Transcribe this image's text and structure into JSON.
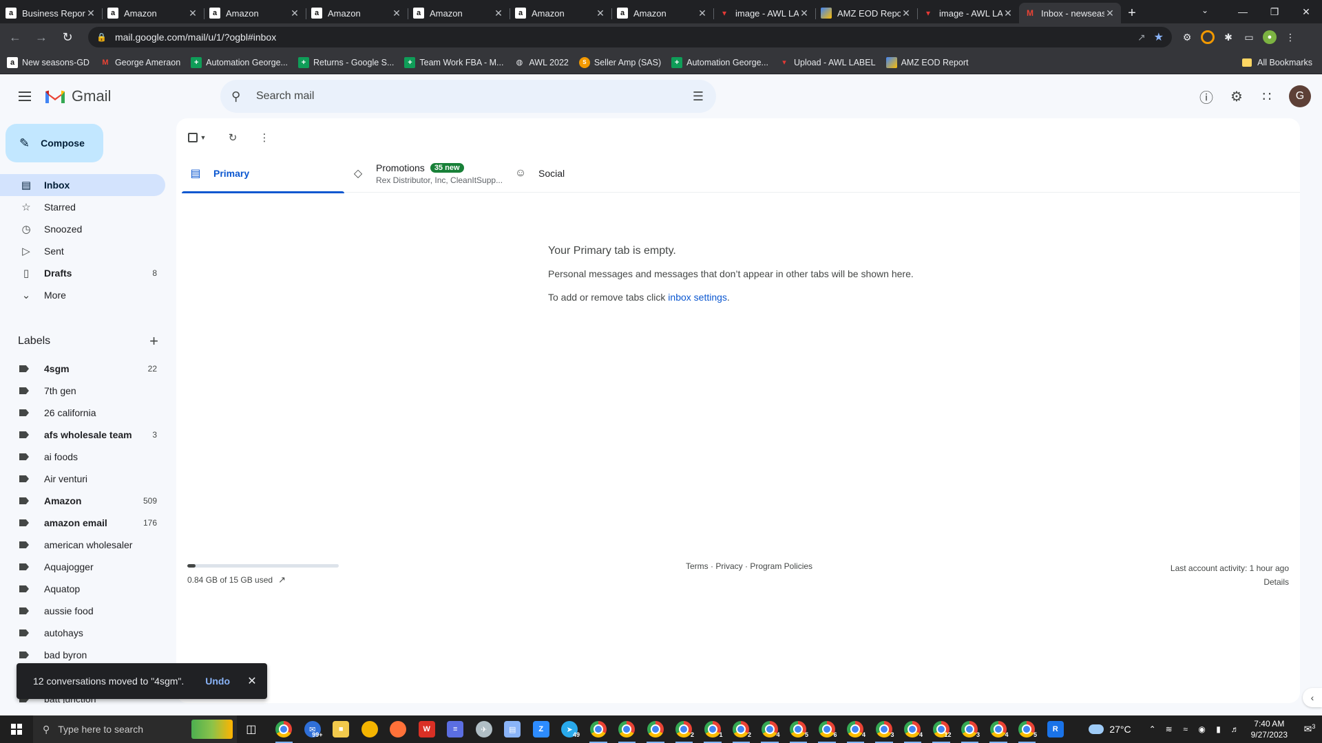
{
  "browser": {
    "tabs": [
      {
        "title": "Business Reports",
        "icon": "amazon-icon"
      },
      {
        "title": "Amazon",
        "icon": "amazon-icon"
      },
      {
        "title": "Amazon",
        "icon": "amazon-icon"
      },
      {
        "title": "Amazon",
        "icon": "amazon-icon"
      },
      {
        "title": "Amazon",
        "icon": "amazon-icon"
      },
      {
        "title": "Amazon",
        "icon": "amazon-icon"
      },
      {
        "title": "Amazon",
        "icon": "amazon-icon"
      },
      {
        "title": "image - AWL LABEL",
        "icon": "awl-icon"
      },
      {
        "title": "AMZ EOD Report",
        "icon": "eod-icon"
      },
      {
        "title": "image - AWL LABEL",
        "icon": "awl-icon"
      },
      {
        "title": "Inbox - newseasons",
        "icon": "gmail-icon",
        "active": true
      }
    ],
    "url": "mail.google.com/mail/u/1/?ogbl#inbox",
    "bookmarks": [
      {
        "label": "New seasons-GD",
        "icon": "amazon-icon"
      },
      {
        "label": "George Ameraon",
        "icon": "gmail-icon"
      },
      {
        "label": "Automation George...",
        "icon": "sheets-icon"
      },
      {
        "label": "Returns - Google S...",
        "icon": "sheets-icon"
      },
      {
        "label": "Team Work FBA - M...",
        "icon": "sheets-icon"
      },
      {
        "label": "AWL 2022",
        "icon": "globe-icon"
      },
      {
        "label": "Seller Amp (SAS)",
        "icon": "selleramp-icon"
      },
      {
        "label": "Automation George...",
        "icon": "sheets-icon"
      },
      {
        "label": "Upload - AWL LABEL",
        "icon": "awl-icon"
      },
      {
        "label": "AMZ EOD Report",
        "icon": "eod-icon"
      }
    ],
    "all_bookmarks": "All Bookmarks"
  },
  "gmail": {
    "product": "Gmail",
    "search_placeholder": "Search mail",
    "avatar_letter": "G",
    "compose": "Compose",
    "nav": [
      {
        "label": "Inbox",
        "icon": "inbox-icon",
        "count": "",
        "active": true
      },
      {
        "label": "Starred",
        "icon": "star-icon",
        "count": ""
      },
      {
        "label": "Snoozed",
        "icon": "clock-icon",
        "count": ""
      },
      {
        "label": "Sent",
        "icon": "send-icon",
        "count": ""
      },
      {
        "label": "Drafts",
        "icon": "draft-icon",
        "count": "8",
        "bold": true
      },
      {
        "label": "More",
        "icon": "chevron-down-icon",
        "count": ""
      }
    ],
    "labels_title": "Labels",
    "labels": [
      {
        "name": "4sgm",
        "count": "22",
        "bold": true
      },
      {
        "name": "7th gen",
        "count": ""
      },
      {
        "name": "26 california",
        "count": ""
      },
      {
        "name": "afs wholesale team",
        "count": "3",
        "bold": true
      },
      {
        "name": "ai foods",
        "count": ""
      },
      {
        "name": "Air venturi",
        "count": ""
      },
      {
        "name": "Amazon",
        "count": "509",
        "bold": true
      },
      {
        "name": "amazon email",
        "count": "176",
        "bold": true
      },
      {
        "name": "american wholesaler",
        "count": ""
      },
      {
        "name": "Aquajogger",
        "count": ""
      },
      {
        "name": "Aquatop",
        "count": ""
      },
      {
        "name": "aussie food",
        "count": ""
      },
      {
        "name": "autohays",
        "count": ""
      },
      {
        "name": "bad byron",
        "count": ""
      },
      {
        "name": "",
        "count": ""
      },
      {
        "name": "batt junction",
        "count": ""
      }
    ],
    "inbox_tabs": [
      {
        "label": "Primary",
        "icon": "inbox-icon",
        "active": true
      },
      {
        "label": "Promotions",
        "icon": "tag-icon",
        "badge": "35 new",
        "sub": "Rex Distributor, Inc, CleanItSupp..."
      },
      {
        "label": "Social",
        "icon": "people-icon"
      }
    ],
    "empty": {
      "heading": "Your Primary tab is empty.",
      "line1": "Personal messages and messages that don’t appear in other tabs will be shown here.",
      "line2_prefix": "To add or remove tabs click ",
      "line2_link": "inbox settings",
      "line2_suffix": "."
    },
    "footer": {
      "storage_used": "0.84 GB of 15 GB used",
      "storage_fraction": 0.056,
      "policies": "Terms · Privacy · Program Policies",
      "activity": "Last account activity: 1 hour ago",
      "details": "Details"
    },
    "snackbar": {
      "message": "12 conversations moved to \"4sgm\".",
      "action": "Undo"
    }
  },
  "taskbar": {
    "search_placeholder": "Type here to search",
    "apps": [
      {
        "name": "chrome",
        "badge": ""
      },
      {
        "name": "mail",
        "badge": "99+"
      },
      {
        "name": "file-explorer",
        "badge": ""
      },
      {
        "name": "chrome-canary",
        "badge": ""
      },
      {
        "name": "firefox",
        "badge": ""
      },
      {
        "name": "wps",
        "badge": ""
      },
      {
        "name": "calculator",
        "badge": ""
      },
      {
        "name": "app-bird",
        "badge": ""
      },
      {
        "name": "notepad",
        "badge": ""
      },
      {
        "name": "zoom",
        "badge": ""
      },
      {
        "name": "telegram",
        "badge": "49"
      },
      {
        "name": "chrome",
        "badge": ""
      },
      {
        "name": "chrome",
        "badge": ""
      },
      {
        "name": "chrome",
        "badge": ""
      },
      {
        "name": "chrome",
        "badge": "2"
      },
      {
        "name": "chrome",
        "badge": "1"
      },
      {
        "name": "chrome",
        "badge": "2"
      },
      {
        "name": "chrome",
        "badge": "4"
      },
      {
        "name": "chrome",
        "badge": "5"
      },
      {
        "name": "chrome",
        "badge": "6"
      },
      {
        "name": "chrome",
        "badge": "4"
      },
      {
        "name": "chrome",
        "badge": "3"
      },
      {
        "name": "chrome",
        "badge": "4"
      },
      {
        "name": "chrome",
        "badge": "12"
      },
      {
        "name": "chrome",
        "badge": "3"
      },
      {
        "name": "chrome",
        "badge": "4"
      },
      {
        "name": "chrome",
        "badge": "5"
      },
      {
        "name": "app-r",
        "badge": ""
      }
    ],
    "weather": "27°C",
    "time": "7:40 AM",
    "date": "9/27/2023",
    "notifications": "3"
  },
  "colors": {
    "accent": "#0b57d0",
    "compose_bg": "#c2e7ff",
    "active_nav": "#d3e3fd",
    "badge_green": "#188038"
  }
}
